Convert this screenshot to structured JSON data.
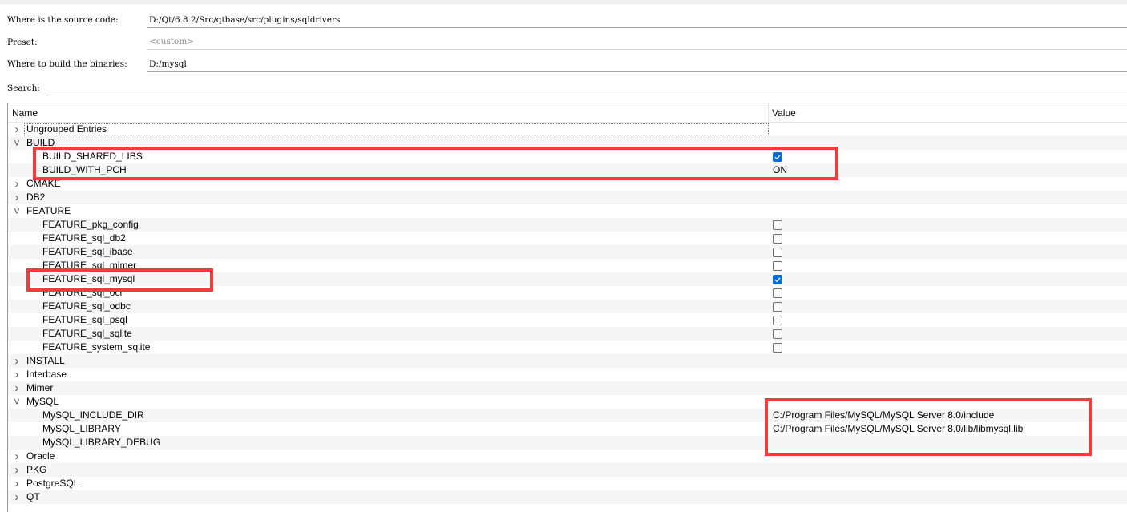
{
  "form": {
    "source_label": "Where is the source code:",
    "source_value": "D:/Qt/6.8.2/Src/qtbase/src/plugins/sqldrivers",
    "preset_label": "Preset:",
    "preset_value": "<custom>",
    "build_label": "Where to build the binaries:",
    "build_value": "D:/mysql",
    "search_label": "Search:",
    "search_value": ""
  },
  "tree": {
    "headers": {
      "name": "Name",
      "value": "Value"
    },
    "rows": [
      {
        "label": "Ungrouped Entries",
        "type": "group",
        "expanded": false,
        "focused": true
      },
      {
        "label": "BUILD",
        "type": "group",
        "expanded": true
      },
      {
        "label": "BUILD_SHARED_LIBS",
        "type": "bool",
        "checked": true
      },
      {
        "label": "BUILD_WITH_PCH",
        "type": "text",
        "value": "ON"
      },
      {
        "label": "CMAKE",
        "type": "group",
        "expanded": false
      },
      {
        "label": "DB2",
        "type": "group",
        "expanded": false
      },
      {
        "label": "FEATURE",
        "type": "group",
        "expanded": true
      },
      {
        "label": "FEATURE_pkg_config",
        "type": "bool",
        "checked": false
      },
      {
        "label": "FEATURE_sql_db2",
        "type": "bool",
        "checked": false
      },
      {
        "label": "FEATURE_sql_ibase",
        "type": "bool",
        "checked": false
      },
      {
        "label": "FEATURE_sql_mimer",
        "type": "bool",
        "checked": false
      },
      {
        "label": "FEATURE_sql_mysql",
        "type": "bool",
        "checked": true
      },
      {
        "label": "FEATURE_sql_oci",
        "type": "bool",
        "checked": false
      },
      {
        "label": "FEATURE_sql_odbc",
        "type": "bool",
        "checked": false
      },
      {
        "label": "FEATURE_sql_psql",
        "type": "bool",
        "checked": false
      },
      {
        "label": "FEATURE_sql_sqlite",
        "type": "bool",
        "checked": false
      },
      {
        "label": "FEATURE_system_sqlite",
        "type": "bool",
        "checked": false
      },
      {
        "label": "INSTALL",
        "type": "group",
        "expanded": false
      },
      {
        "label": "Interbase",
        "type": "group",
        "expanded": false
      },
      {
        "label": "Mimer",
        "type": "group",
        "expanded": false
      },
      {
        "label": "MySQL",
        "type": "group",
        "expanded": true
      },
      {
        "label": "MySQL_INCLUDE_DIR",
        "type": "text",
        "value": "C:/Program Files/MySQL/MySQL Server 8.0/include"
      },
      {
        "label": "MySQL_LIBRARY",
        "type": "text",
        "value": "C:/Program Files/MySQL/MySQL Server 8.0/lib/libmysql.lib"
      },
      {
        "label": "MySQL_LIBRARY_DEBUG",
        "type": "text",
        "value": ""
      },
      {
        "label": "Oracle",
        "type": "group",
        "expanded": false
      },
      {
        "label": "PKG",
        "type": "group",
        "expanded": false
      },
      {
        "label": "PostgreSQL",
        "type": "group",
        "expanded": false
      },
      {
        "label": "QT",
        "type": "group",
        "expanded": false
      }
    ]
  },
  "colors": {
    "checkbox_checked": "#0a6cce",
    "annotation_red": "#f03c3c",
    "row_alt": "#f5f5f5"
  }
}
